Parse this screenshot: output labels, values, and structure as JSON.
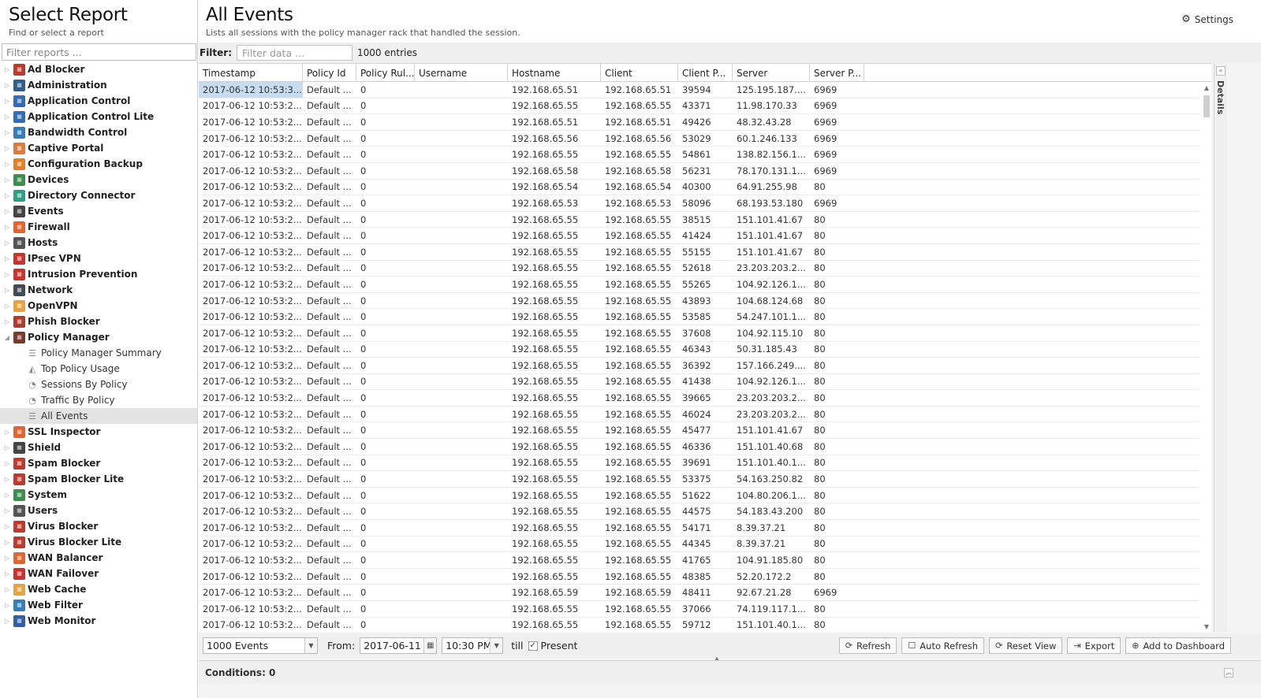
{
  "sidebar": {
    "title": "Select Report",
    "subtitle": "Find or select a report",
    "filter_placeholder": "Filter reports ...",
    "categories": [
      {
        "label": "Ad Blocker",
        "icon": "ad-blocker-icon",
        "color": "#c0392b",
        "expanded": false
      },
      {
        "label": "Administration",
        "icon": "administration-icon",
        "color": "#2c5f8a",
        "expanded": false
      },
      {
        "label": "Application Control",
        "icon": "application-control-icon",
        "color": "#2d6eb8",
        "expanded": false
      },
      {
        "label": "Application Control Lite",
        "icon": "application-control-lite-icon",
        "color": "#2d6eb8",
        "expanded": false
      },
      {
        "label": "Bandwidth Control",
        "icon": "bandwidth-control-icon",
        "color": "#2f7fbd",
        "expanded": false
      },
      {
        "label": "Captive Portal",
        "icon": "captive-portal-icon",
        "color": "#e07b39",
        "expanded": false
      },
      {
        "label": "Configuration Backup",
        "icon": "configuration-backup-icon",
        "color": "#e67e22",
        "expanded": false
      },
      {
        "label": "Devices",
        "icon": "devices-icon",
        "color": "#3a8f4b",
        "expanded": false
      },
      {
        "label": "Directory Connector",
        "icon": "directory-connector-icon",
        "color": "#2aa08a",
        "expanded": false
      },
      {
        "label": "Events",
        "icon": "events-icon",
        "color": "#444444",
        "expanded": false
      },
      {
        "label": "Firewall",
        "icon": "firewall-icon",
        "color": "#e8622a",
        "expanded": false
      },
      {
        "label": "Hosts",
        "icon": "hosts-icon",
        "color": "#555555",
        "expanded": false
      },
      {
        "label": "IPsec VPN",
        "icon": "ipsec-vpn-icon",
        "color": "#d1302a",
        "expanded": false
      },
      {
        "label": "Intrusion Prevention",
        "icon": "intrusion-prevention-icon",
        "color": "#d1302a",
        "expanded": false
      },
      {
        "label": "Network",
        "icon": "network-icon",
        "color": "#444a55",
        "expanded": false
      },
      {
        "label": "OpenVPN",
        "icon": "openvpn-icon",
        "color": "#e8a33a",
        "expanded": false
      },
      {
        "label": "Phish Blocker",
        "icon": "phish-blocker-icon",
        "color": "#b13a2a",
        "expanded": false
      },
      {
        "label": "Policy Manager",
        "icon": "policy-manager-icon",
        "color": "#7a3a2a",
        "expanded": true,
        "children": [
          {
            "label": "Policy Manager Summary",
            "icon": "text-report-icon",
            "selected": false
          },
          {
            "label": "Top Policy Usage",
            "icon": "area-chart-icon",
            "selected": false
          },
          {
            "label": "Sessions By Policy",
            "icon": "pie-chart-icon",
            "selected": false
          },
          {
            "label": "Traffic By Policy",
            "icon": "pie-chart-icon",
            "selected": false
          },
          {
            "label": "All Events",
            "icon": "list-icon",
            "selected": true
          }
        ]
      },
      {
        "label": "SSL Inspector",
        "icon": "ssl-inspector-icon",
        "color": "#e8622a",
        "expanded": false
      },
      {
        "label": "Shield",
        "icon": "shield-icon",
        "color": "#444444",
        "expanded": false
      },
      {
        "label": "Spam Blocker",
        "icon": "spam-blocker-icon",
        "color": "#c0392b",
        "expanded": false
      },
      {
        "label": "Spam Blocker Lite",
        "icon": "spam-blocker-lite-icon",
        "color": "#c0392b",
        "expanded": false
      },
      {
        "label": "System",
        "icon": "system-icon",
        "color": "#3a8f4b",
        "expanded": false
      },
      {
        "label": "Users",
        "icon": "users-icon",
        "color": "#555555",
        "expanded": false
      },
      {
        "label": "Virus Blocker",
        "icon": "virus-blocker-icon",
        "color": "#c0392b",
        "expanded": false
      },
      {
        "label": "Virus Blocker Lite",
        "icon": "virus-blocker-lite-icon",
        "color": "#c0392b",
        "expanded": false
      },
      {
        "label": "WAN Balancer",
        "icon": "wan-balancer-icon",
        "color": "#e8622a",
        "expanded": false
      },
      {
        "label": "WAN Failover",
        "icon": "wan-failover-icon",
        "color": "#d1302a",
        "expanded": false
      },
      {
        "label": "Web Cache",
        "icon": "web-cache-icon",
        "color": "#e8a33a",
        "expanded": false
      },
      {
        "label": "Web Filter",
        "icon": "web-filter-icon",
        "color": "#2f7fbd",
        "expanded": false
      },
      {
        "label": "Web Monitor",
        "icon": "web-monitor-icon",
        "color": "#2f5fa8",
        "expanded": false
      }
    ]
  },
  "main": {
    "title": "All Events",
    "subtitle": "Lists all sessions with the policy manager rack that handled the session.",
    "settings_label": "Settings",
    "filter_label": "Filter:",
    "filter_placeholder": "Filter data ...",
    "entries": "1000 entries",
    "details_label": "Details"
  },
  "grid": {
    "columns": [
      "Timestamp",
      "Policy Id",
      "Policy Rul...",
      "Username",
      "Hostname",
      "Client",
      "Client P...",
      "Server",
      "Server P..."
    ],
    "rows": [
      [
        "2017-06-12 10:53:3...",
        "Default ...",
        "0",
        "",
        "192.168.65.51",
        "192.168.65.51",
        "39594",
        "125.195.187....",
        "6969"
      ],
      [
        "2017-06-12 10:53:2...",
        "Default ...",
        "0",
        "",
        "192.168.65.55",
        "192.168.65.55",
        "43371",
        "11.98.170.33",
        "6969"
      ],
      [
        "2017-06-12 10:53:2...",
        "Default ...",
        "0",
        "",
        "192.168.65.51",
        "192.168.65.51",
        "49426",
        "48.32.43.28",
        "6969"
      ],
      [
        "2017-06-12 10:53:2...",
        "Default ...",
        "0",
        "",
        "192.168.65.56",
        "192.168.65.56",
        "53029",
        "60.1.246.133",
        "6969"
      ],
      [
        "2017-06-12 10:53:2...",
        "Default ...",
        "0",
        "",
        "192.168.65.55",
        "192.168.65.55",
        "54861",
        "138.82.156.1...",
        "6969"
      ],
      [
        "2017-06-12 10:53:2...",
        "Default ...",
        "0",
        "",
        "192.168.65.58",
        "192.168.65.58",
        "56231",
        "78.170.131.1...",
        "6969"
      ],
      [
        "2017-06-12 10:53:2...",
        "Default ...",
        "0",
        "",
        "192.168.65.54",
        "192.168.65.54",
        "40300",
        "64.91.255.98",
        "80"
      ],
      [
        "2017-06-12 10:53:2...",
        "Default ...",
        "0",
        "",
        "192.168.65.53",
        "192.168.65.53",
        "58096",
        "68.193.53.180",
        "6969"
      ],
      [
        "2017-06-12 10:53:2...",
        "Default ...",
        "0",
        "",
        "192.168.65.55",
        "192.168.65.55",
        "38515",
        "151.101.41.67",
        "80"
      ],
      [
        "2017-06-12 10:53:2...",
        "Default ...",
        "0",
        "",
        "192.168.65.55",
        "192.168.65.55",
        "41424",
        "151.101.41.67",
        "80"
      ],
      [
        "2017-06-12 10:53:2...",
        "Default ...",
        "0",
        "",
        "192.168.65.55",
        "192.168.65.55",
        "55155",
        "151.101.41.67",
        "80"
      ],
      [
        "2017-06-12 10:53:2...",
        "Default ...",
        "0",
        "",
        "192.168.65.55",
        "192.168.65.55",
        "52618",
        "23.203.203.2...",
        "80"
      ],
      [
        "2017-06-12 10:53:2...",
        "Default ...",
        "0",
        "",
        "192.168.65.55",
        "192.168.65.55",
        "55265",
        "104.92.126.1...",
        "80"
      ],
      [
        "2017-06-12 10:53:2...",
        "Default ...",
        "0",
        "",
        "192.168.65.55",
        "192.168.65.55",
        "43893",
        "104.68.124.68",
        "80"
      ],
      [
        "2017-06-12 10:53:2...",
        "Default ...",
        "0",
        "",
        "192.168.65.55",
        "192.168.65.55",
        "53585",
        "54.247.101.1...",
        "80"
      ],
      [
        "2017-06-12 10:53:2...",
        "Default ...",
        "0",
        "",
        "192.168.65.55",
        "192.168.65.55",
        "37608",
        "104.92.115.10",
        "80"
      ],
      [
        "2017-06-12 10:53:2...",
        "Default ...",
        "0",
        "",
        "192.168.65.55",
        "192.168.65.55",
        "46343",
        "50.31.185.43",
        "80"
      ],
      [
        "2017-06-12 10:53:2...",
        "Default ...",
        "0",
        "",
        "192.168.65.55",
        "192.168.65.55",
        "36392",
        "157.166.249....",
        "80"
      ],
      [
        "2017-06-12 10:53:2...",
        "Default ...",
        "0",
        "",
        "192.168.65.55",
        "192.168.65.55",
        "41438",
        "104.92.126.1...",
        "80"
      ],
      [
        "2017-06-12 10:53:2...",
        "Default ...",
        "0",
        "",
        "192.168.65.55",
        "192.168.65.55",
        "39665",
        "23.203.203.2...",
        "80"
      ],
      [
        "2017-06-12 10:53:2...",
        "Default ...",
        "0",
        "",
        "192.168.65.55",
        "192.168.65.55",
        "46024",
        "23.203.203.2...",
        "80"
      ],
      [
        "2017-06-12 10:53:2...",
        "Default ...",
        "0",
        "",
        "192.168.65.55",
        "192.168.65.55",
        "45477",
        "151.101.41.67",
        "80"
      ],
      [
        "2017-06-12 10:53:2...",
        "Default ...",
        "0",
        "",
        "192.168.65.55",
        "192.168.65.55",
        "46336",
        "151.101.40.68",
        "80"
      ],
      [
        "2017-06-12 10:53:2...",
        "Default ...",
        "0",
        "",
        "192.168.65.55",
        "192.168.65.55",
        "39691",
        "151.101.40.1...",
        "80"
      ],
      [
        "2017-06-12 10:53:2...",
        "Default ...",
        "0",
        "",
        "192.168.65.55",
        "192.168.65.55",
        "53375",
        "54.163.250.82",
        "80"
      ],
      [
        "2017-06-12 10:53:2...",
        "Default ...",
        "0",
        "",
        "192.168.65.55",
        "192.168.65.55",
        "51622",
        "104.80.206.1...",
        "80"
      ],
      [
        "2017-06-12 10:53:2...",
        "Default ...",
        "0",
        "",
        "192.168.65.55",
        "192.168.65.55",
        "44575",
        "54.183.43.200",
        "80"
      ],
      [
        "2017-06-12 10:53:2...",
        "Default ...",
        "0",
        "",
        "192.168.65.55",
        "192.168.65.55",
        "54171",
        "8.39.37.21",
        "80"
      ],
      [
        "2017-06-12 10:53:2...",
        "Default ...",
        "0",
        "",
        "192.168.65.55",
        "192.168.65.55",
        "44345",
        "8.39.37.21",
        "80"
      ],
      [
        "2017-06-12 10:53:2...",
        "Default ...",
        "0",
        "",
        "192.168.65.55",
        "192.168.65.55",
        "41765",
        "104.91.185.80",
        "80"
      ],
      [
        "2017-06-12 10:53:2...",
        "Default ...",
        "0",
        "",
        "192.168.65.55",
        "192.168.65.55",
        "48385",
        "52.20.172.2",
        "80"
      ],
      [
        "2017-06-12 10:53:2...",
        "Default ...",
        "0",
        "",
        "192.168.65.59",
        "192.168.65.59",
        "48411",
        "92.67.21.28",
        "6969"
      ],
      [
        "2017-06-12 10:53:2...",
        "Default ...",
        "0",
        "",
        "192.168.65.55",
        "192.168.65.55",
        "37066",
        "74.119.117.1...",
        "80"
      ],
      [
        "2017-06-12 10:53:2...",
        "Default ...",
        "0",
        "",
        "192.168.65.55",
        "192.168.65.55",
        "59712",
        "151.101.40.1...",
        "80"
      ]
    ]
  },
  "bottom": {
    "limit": "1000 Events",
    "from_label": "From:",
    "from_date": "2017-06-11",
    "from_time": "10:30 PM",
    "till_label": "till",
    "present_label": "Present",
    "present_checked": true,
    "buttons": [
      {
        "label": "Refresh",
        "icon": "refresh-icon"
      },
      {
        "label": "Auto Refresh",
        "icon": "checkbox-icon"
      },
      {
        "label": "Reset View",
        "icon": "reset-icon"
      },
      {
        "label": "Export",
        "icon": "export-icon"
      },
      {
        "label": "Add to Dashboard",
        "icon": "add-icon"
      }
    ],
    "conditions_label": "Conditions: 0"
  }
}
